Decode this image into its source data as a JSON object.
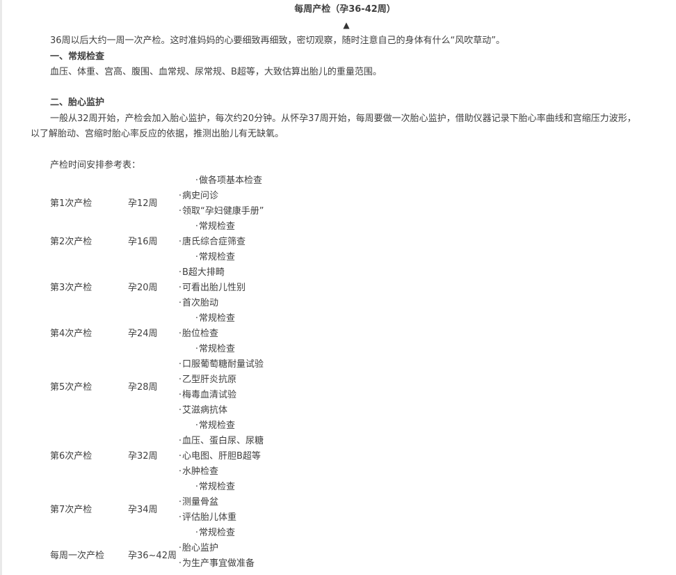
{
  "header": {
    "title": "每周产检（孕36-42周）",
    "arrow": "▲"
  },
  "intro": "36周以后大约一周一次产检。这时准妈妈的心要细致再细致，密切观察，随时注意自己的身体有什么“风吹草动”。",
  "section1": {
    "heading": "一、常规检查",
    "body": "血压、体重、宫高、腹围、血常规、尿常规、B超等，大致估算出胎儿的重量范围。"
  },
  "section2": {
    "heading": "二、胎心监护",
    "body": "一般从32周开始，产检会加入胎心监护，每次约20分钟。从怀孕37周开始，每周要做一次胎心监护，借助仪器记录下胎心率曲线和宫缩压力波形，以了解胎动、宫缩时胎心率反应的依据，推测出胎儿有无缺氧。"
  },
  "schedule": {
    "caption": "产检时间安排参考表：",
    "rows": [
      {
        "round": "第1次产检",
        "week": "孕12周",
        "items": [
          "做各项基本检查",
          "病史问诊",
          "领取“孕妇健康手册”"
        ]
      },
      {
        "round": "第2次产检",
        "week": "孕16周",
        "items": [
          "常规检查",
          "唐氏综合症筛查"
        ]
      },
      {
        "round": "第3次产检",
        "week": "孕20周",
        "items": [
          "常规检查",
          "B超大排畸",
          "可看出胎儿性别",
          "首次胎动"
        ]
      },
      {
        "round": "第4次产检",
        "week": "孕24周",
        "items": [
          "常规检查",
          "胎位检查"
        ]
      },
      {
        "round": "第5次产检",
        "week": "孕28周",
        "items": [
          "常规检查",
          "口服葡萄糖耐量试验",
          "乙型肝炎抗原",
          "梅毒血清试验",
          "艾滋病抗体"
        ]
      },
      {
        "round": "第6次产检",
        "week": "孕32周",
        "items": [
          "常规检查",
          "血压、蛋白尿、尿糖",
          "心电图、肝胆B超等",
          "水肿检查"
        ]
      },
      {
        "round": "第7次产检",
        "week": "孕34周",
        "items": [
          "常规检查",
          "测量骨盆",
          "评估胎儿体重"
        ]
      },
      {
        "round": "每周一次产检",
        "week": "孕36~42周",
        "items": [
          "常规检查",
          "胎心监护",
          "为生产事宜做准备"
        ]
      }
    ]
  }
}
